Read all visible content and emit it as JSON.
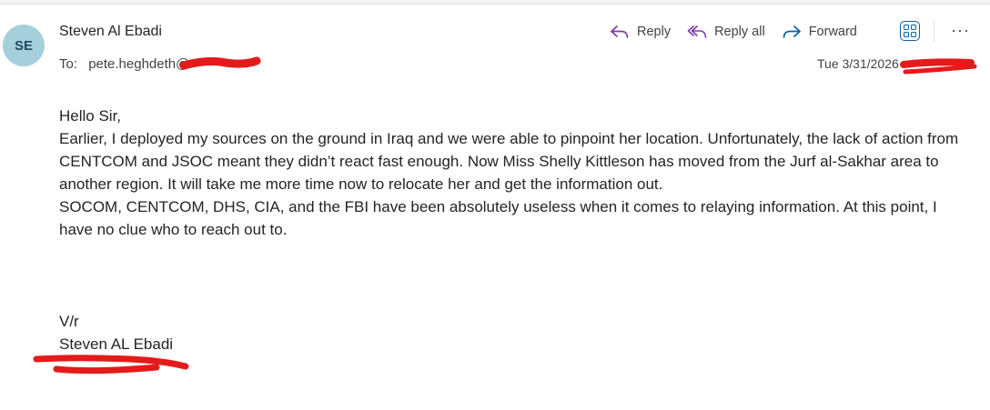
{
  "sender": {
    "initials": "SE",
    "name": "Steven Al Ebadi",
    "avatar_color": "#a6cfdc"
  },
  "recipient": {
    "label": "To:",
    "email_visible": "pete.heghdeth@"
  },
  "toolbar": {
    "reply_label": "Reply",
    "reply_all_label": "Reply all",
    "forward_label": "Forward",
    "more_label": "···",
    "accent_reply": "#7b3aa7",
    "accent_forward": "#115ea3"
  },
  "date": "Tue 3/31/2026",
  "body": {
    "greeting": "Hello Sir,",
    "paragraph1": "Earlier, I deployed my sources on the ground in Iraq and we were able to pinpoint her location. Unfortunately, the lack of action from CENTCOM and JSOC meant they didn’t react fast enough. Now Miss Shelly Kittleson has moved from the Jurf al-Sakhar area to another region. It will take me more time now to relocate her and get the information out.",
    "paragraph2": "SOCOM, CENTCOM, DHS, CIA, and the FBI have been absolutely useless when it comes to relaying information. At this point, I have no clue who to reach out to."
  },
  "signature": {
    "closing": "V/r",
    "name": "Steven AL Ebadi"
  },
  "redaction_color": "#e31b1b"
}
